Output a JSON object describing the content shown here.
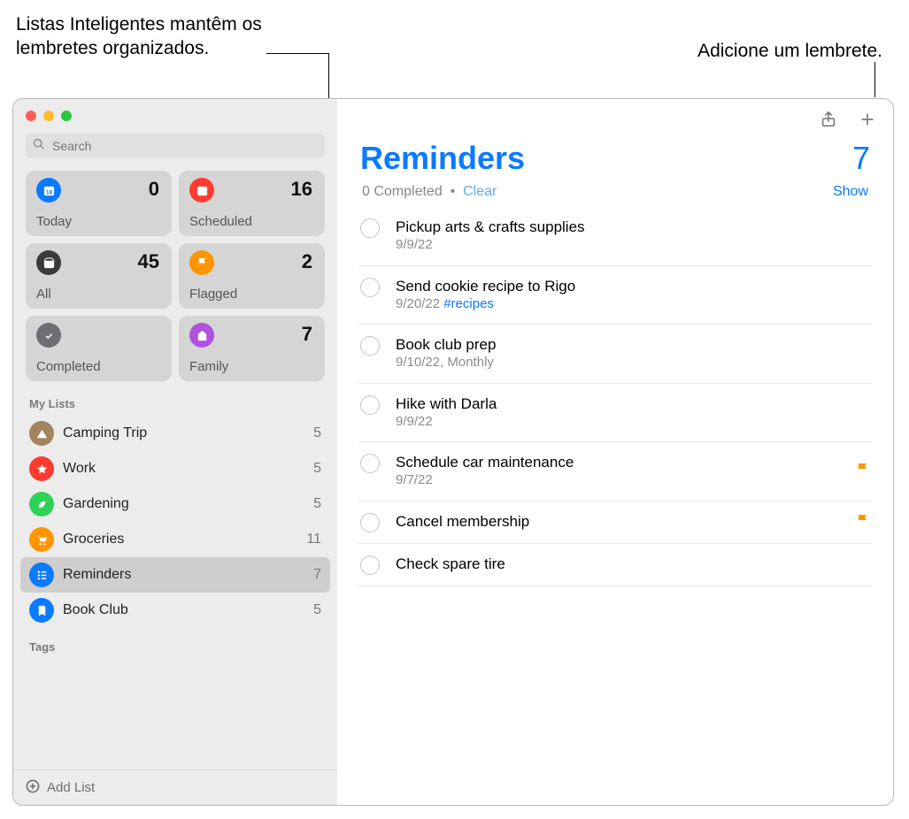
{
  "callouts": {
    "left": "Listas Inteligentes mantêm os lembretes organizados.",
    "right": "Adicione um lembrete."
  },
  "search": {
    "placeholder": "Search"
  },
  "smart": [
    {
      "id": "today",
      "label": "Today",
      "count": 0,
      "color": "#0a7aff"
    },
    {
      "id": "scheduled",
      "label": "Scheduled",
      "count": 16,
      "color": "#ff3b30"
    },
    {
      "id": "all",
      "label": "All",
      "count": 45,
      "color": "#3a3a3c"
    },
    {
      "id": "flagged",
      "label": "Flagged",
      "count": 2,
      "color": "#ff9500"
    },
    {
      "id": "completed",
      "label": "Completed",
      "count": "",
      "color": "#6e6e73"
    },
    {
      "id": "family",
      "label": "Family",
      "count": 7,
      "color": "#af52de"
    }
  ],
  "sections": {
    "mylists": "My Lists",
    "tags": "Tags"
  },
  "lists": [
    {
      "id": "camping",
      "name": "Camping Trip",
      "count": 5,
      "color": "#a2845e"
    },
    {
      "id": "work",
      "name": "Work",
      "count": 5,
      "color": "#ff3b30"
    },
    {
      "id": "garden",
      "name": "Gardening",
      "count": 5,
      "color": "#30d158"
    },
    {
      "id": "grocери",
      "name": "Groceries",
      "count": 11,
      "color": "#ff9500"
    },
    {
      "id": "reminders",
      "name": "Reminders",
      "count": 7,
      "color": "#0a7aff",
      "selected": true
    },
    {
      "id": "bookclub",
      "name": "Book Club",
      "count": 5,
      "color": "#0a7aff"
    }
  ],
  "addlist": "Add List",
  "header": {
    "title": "Reminders",
    "count": 7
  },
  "subheader": {
    "completed": "0 Completed",
    "dot": "·",
    "clear": "Clear",
    "show": "Show"
  },
  "items": [
    {
      "title": "Pickup arts & crafts supplies",
      "sub": "9/9/22"
    },
    {
      "title": "Send cookie recipe to Rigo",
      "sub": "9/20/22 ",
      "tag": "#recipes"
    },
    {
      "title": "Book club prep",
      "sub": "9/10/22, Monthly"
    },
    {
      "title": "Hike with Darla",
      "sub": "9/9/22"
    },
    {
      "title": "Schedule car maintenance",
      "sub": "9/7/22",
      "flagged": true
    },
    {
      "title": "Cancel membership",
      "flagged": true
    },
    {
      "title": "Check spare tire"
    }
  ]
}
